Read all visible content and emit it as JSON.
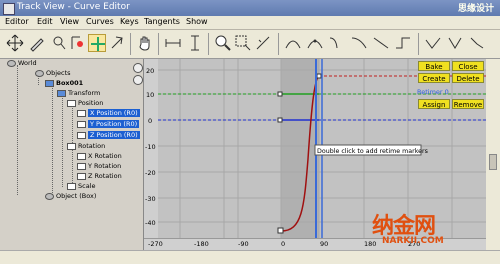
{
  "window": {
    "title": "Track View - Curve Editor",
    "logo_text": "思缘设计"
  },
  "menu": [
    "Editor",
    "Edit",
    "View",
    "Curves",
    "Keys",
    "Tangents",
    "Show"
  ],
  "toolbar_icons": [
    "move-keys-icon",
    "draw-curves-icon",
    "filters-icon",
    "snap-frames-icon",
    "show-keyable-icon",
    "show-tangents-icon",
    "pan-icon",
    "zoom-horizontal-icon",
    "zoom-value-icon",
    "zoom-icon",
    "zoom-region-icon",
    "isolate-curve-icon",
    "custom-tangent-icon",
    "smooth-tangent-icon",
    "fast-tangent-icon",
    "slow-tangent-icon",
    "linear-tangent-icon",
    "step-tangent-icon",
    "auto-tangent-icon",
    "lock-tangents-icon",
    "break-tangents-icon",
    "unify-tangents-icon"
  ],
  "tree": {
    "world": "World",
    "objects": "Objects",
    "box": "Box001",
    "transform": "Transform",
    "position": "Position",
    "xpos": "X Position (R0)",
    "ypos": "Y Position (R0)",
    "zpos": "Z Position (R0)",
    "rotation": "Rotation",
    "xrot": "X Rotation",
    "yrot": "Y Rotation",
    "zrot": "Z Rotation",
    "scale": "Scale",
    "object": "Object (Box)"
  },
  "graph": {
    "y_ticks": [
      "20",
      "10",
      "0",
      "-10",
      "-20",
      "-30",
      "-40"
    ],
    "x_ticks": [
      "-270",
      "-180",
      "-90",
      "0",
      "90",
      "180",
      "270"
    ],
    "tooltip": "Double click to add retime markers",
    "retimer_label": "Retimer 0"
  },
  "buttons": {
    "bake": "Bake",
    "close": "Close",
    "create": "Create",
    "delete": "Delete",
    "assign": "Assign",
    "remove": "Remove"
  },
  "watermark": {
    "main": "纳金网",
    "sub": "NARKII.COM"
  }
}
